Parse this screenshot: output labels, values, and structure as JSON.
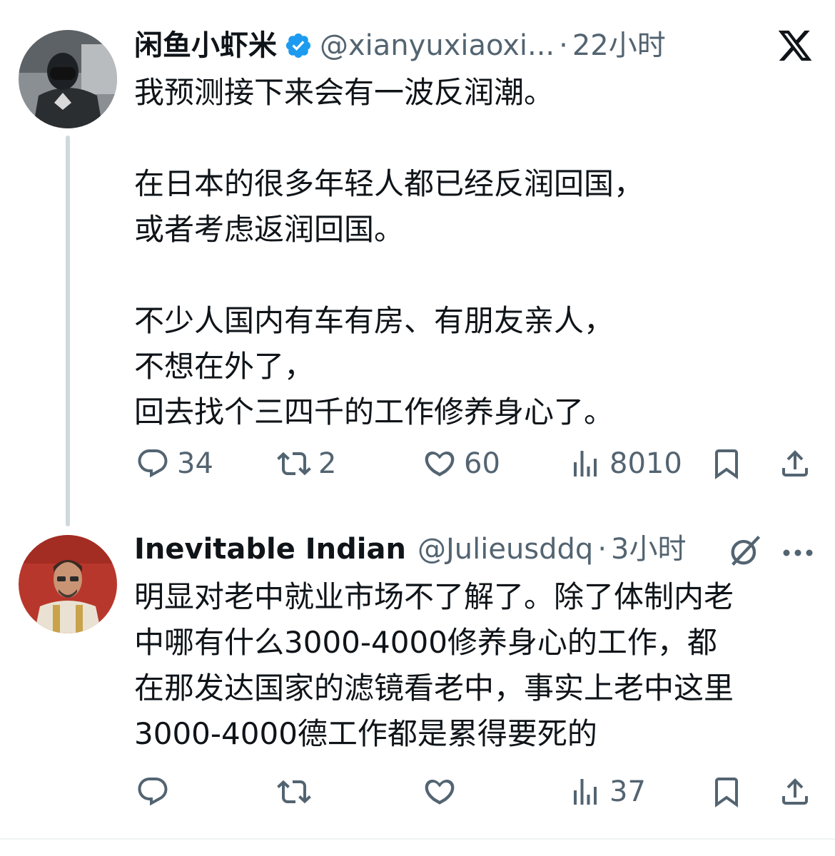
{
  "tweet1": {
    "display_name": "闲鱼小虾米",
    "handle": "@xianyuxiaoxi...",
    "separator": "·",
    "time": "22小时",
    "text": "我预测接下来会有一波反润潮。\n\n在日本的很多年轻人都已经反润回国，\n或者考虑返润回国。\n\n不少人国内有车有房、有朋友亲人，\n不想在外了，\n回去找个三四千的工作修养身心了。",
    "replies": "34",
    "reposts": "2",
    "likes": "60",
    "views": "8010",
    "verified": true,
    "verified_color": "#1d9bf0"
  },
  "tweet2": {
    "display_name": "Inevitable Indian",
    "handle": "@Julieusddq",
    "separator": "·",
    "time": "3小时",
    "text": "明显对老中就业市场不了解了。除了体制内老\n中哪有什么3000-4000修养身心的工作，都\n在那发达国家的滤镜看老中，事实上老中这里\n3000-4000德工作都是累得要死的",
    "views": "37"
  },
  "icons": {
    "top_right": "x-logo-icon",
    "grok": "grok-slash-icon",
    "more": "more-dots-icon",
    "reply": "reply-bubble-icon",
    "repost": "repost-arrows-icon",
    "like": "heart-icon",
    "views": "views-bars-icon",
    "bookmark": "bookmark-icon",
    "share": "share-upload-icon"
  },
  "colors": {
    "text_primary": "#0f1419",
    "text_secondary": "#536471",
    "thread_line": "#cfd9de",
    "accent": "#1d9bf0"
  }
}
